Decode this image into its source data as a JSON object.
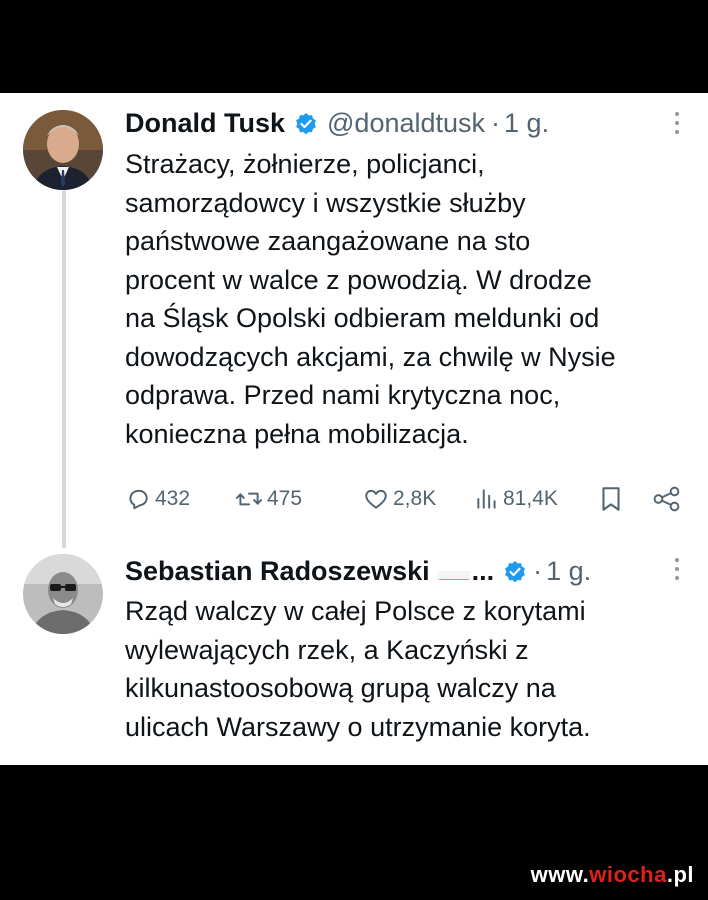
{
  "tweet1": {
    "name": "Donald Tusk",
    "handle": "@donaldtusk",
    "separator": "·",
    "time": "1 g.",
    "lines": [
      "Strażacy, żołnierze, policjanci,",
      "samorządowcy i wszystkie służby",
      "państwowe zaangażowane na sto",
      "procent w walce z powodzią. W drodze",
      "na Śląsk Opolski odbieram meldunki od",
      "dowodzących akcjami, za chwilę w Nysie",
      "odprawa. Przed nami krytyczna noc,",
      "konieczna pełna mobilizacja."
    ],
    "stats": {
      "replies": "432",
      "retweets": "475",
      "likes": "2,8K",
      "views": "81,4K"
    }
  },
  "tweet2": {
    "name": "Sebastian Radoszewski",
    "ellipsis": "...",
    "separator": "·",
    "time": "1 g.",
    "lines": [
      "Rząd walczy w całej Polsce z korytami",
      "wylewających rzek, a Kaczyński z",
      "kilkunastoosobową grupą walczy na",
      "ulicach Warszawy o utrzymanie koryta."
    ]
  },
  "watermark": {
    "prefix": "www.",
    "highlight": "wiocha",
    "suffix": ".pl"
  },
  "colors": {
    "verified": "#1d9bf0",
    "muted": "#536471",
    "watermark_highlight": "#e02020"
  },
  "icons": [
    "reply-icon",
    "retweet-icon",
    "like-icon",
    "views-icon",
    "bookmark-icon",
    "share-icon",
    "verified-badge-icon",
    "more-icon",
    "poland-flag-icon"
  ]
}
